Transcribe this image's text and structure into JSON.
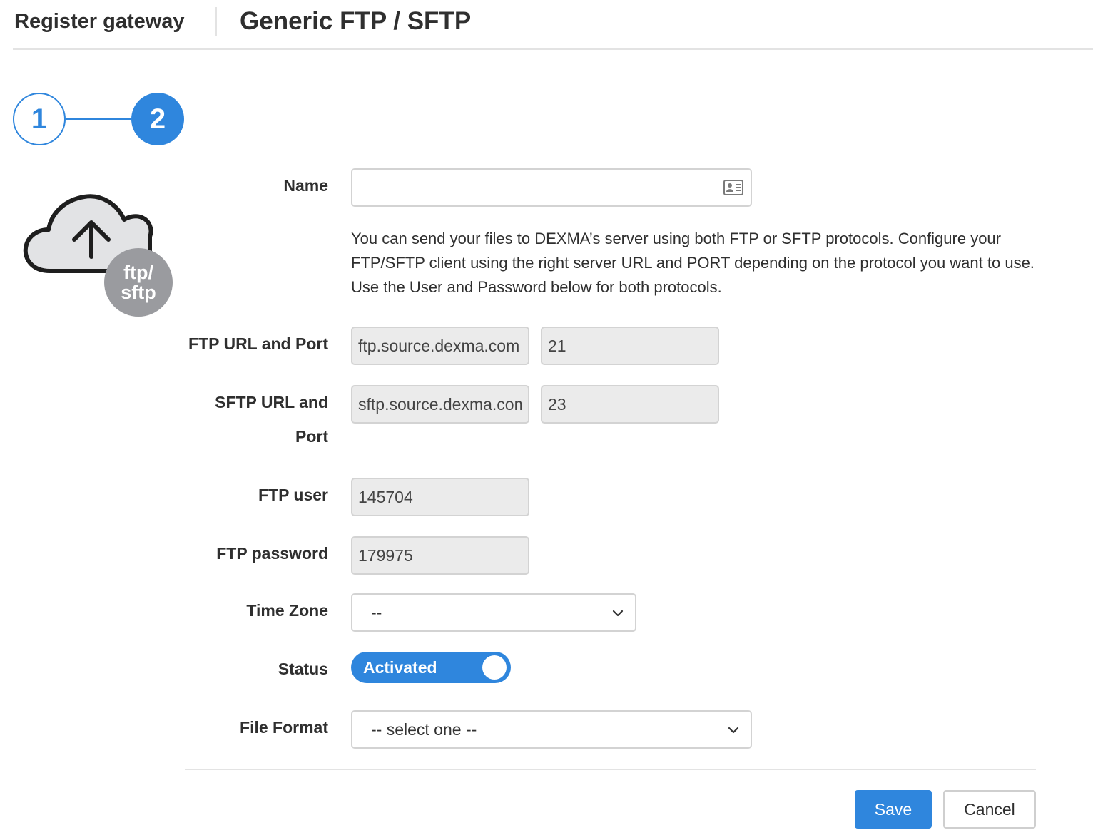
{
  "header": {
    "breadcrumb": "Register gateway",
    "title": "Generic FTP / SFTP"
  },
  "stepper": {
    "steps": [
      "1",
      "2"
    ],
    "active_step": "2",
    "accent_color": "#2f86dd"
  },
  "logo": {
    "icon": "cloud-upload-icon",
    "badge_line1": "ftp/",
    "badge_line2": "sftp"
  },
  "form": {
    "name": {
      "label": "Name",
      "value": "",
      "icon": "contact-card-icon"
    },
    "help_text": "You can send your files to DEXMA’s server using both FTP or SFTP protocols. Configure your FTP/SFTP client using the right server URL and PORT depending on the protocol you want to use. Use the User and Password below for both protocols.",
    "ftp": {
      "label": "FTP URL and Port",
      "url": "ftp.source.dexma.com",
      "port": "21"
    },
    "sftp": {
      "label_line1": "SFTP URL and",
      "label_line2": "Port",
      "url": "sftp.source.dexma.com",
      "port": "23"
    },
    "user": {
      "label": "FTP user",
      "value": "145704"
    },
    "password": {
      "label": "FTP password",
      "value": "179975"
    },
    "timezone": {
      "label": "Time Zone",
      "value": "--"
    },
    "status": {
      "label": "Status",
      "value": "Activated",
      "on": true
    },
    "file_format": {
      "label": "File Format",
      "value": "-- select one --"
    }
  },
  "actions": {
    "save": "Save",
    "cancel": "Cancel"
  }
}
